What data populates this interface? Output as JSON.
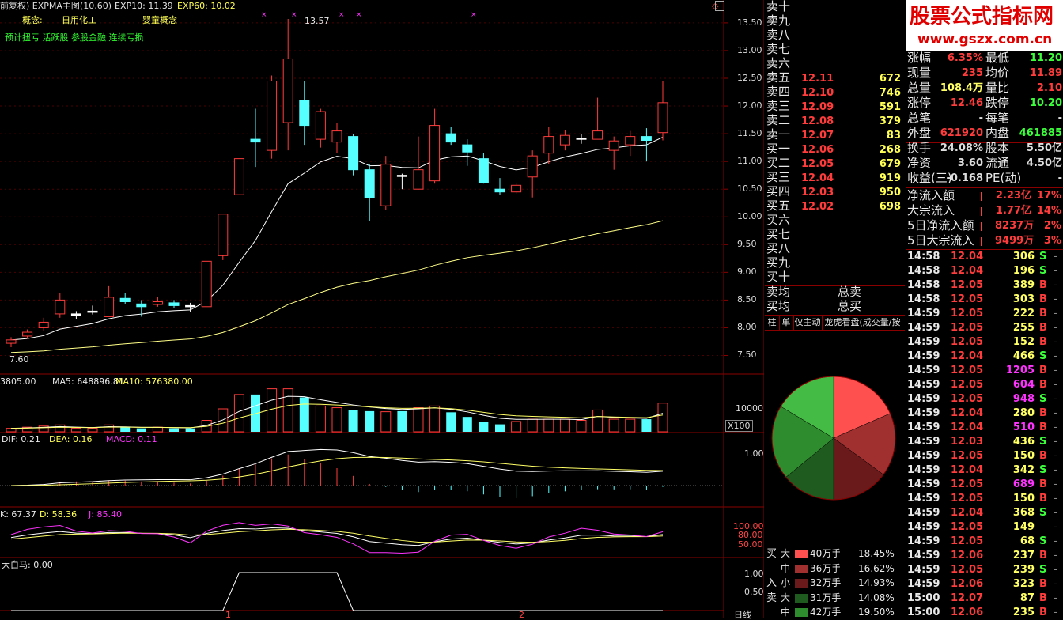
{
  "main_chart": {
    "title": "前复权) EXPMA主图(10,60)",
    "exp10": "EXP10: 11.39",
    "exp60": "EXP60: 10.02",
    "concept_label": "概念:",
    "concept_1": "日用化工",
    "concept_2": "婴童概念",
    "tags": "预计扭亏 活跃股 参股金融 连续亏损",
    "high_mark": "13.57",
    "low_mark": "7.60",
    "price_ticks": [
      "13.50",
      "13.00",
      "12.50",
      "12.00",
      "11.50",
      "11.00",
      "10.50",
      "10.00",
      "9.50",
      "9.00",
      "8.50",
      "8.00",
      "7.50"
    ]
  },
  "volume_panel": {
    "vol": "3805.00",
    "ma5": "MA5: 648896.81",
    "ma10": "MA10: 576380.00",
    "tick": "10000",
    "unit": "X100"
  },
  "macd_panel": {
    "dif": "DIF: 0.21",
    "dea": "DEA: 0.16",
    "macd": "MACD: 0.11",
    "tick": "1.00"
  },
  "kdj_panel": {
    "k": "K: 67.37",
    "d": "D: 58.36",
    "j": "J: 85.40",
    "ticks": [
      "100.00",
      "80.00",
      "50.00"
    ]
  },
  "dbm_panel": {
    "label": "大白马: 0.00",
    "ticks": [
      "1.00",
      "0.50"
    ],
    "axis_1": "1",
    "axis_2": "2",
    "period": "日线"
  },
  "watermark": {
    "title": "股票公式指标网",
    "url": "www.gszx.com.cn"
  },
  "order_book": {
    "sell_empty": [
      "卖十",
      "卖九",
      "卖八",
      "卖七",
      "卖六"
    ],
    "sells": [
      {
        "label": "卖五",
        "price": "12.11",
        "vol": "672"
      },
      {
        "label": "卖四",
        "price": "12.10",
        "vol": "746"
      },
      {
        "label": "卖三",
        "price": "12.09",
        "vol": "591"
      },
      {
        "label": "卖二",
        "price": "12.08",
        "vol": "379"
      },
      {
        "label": "卖一",
        "price": "12.07",
        "vol": "83"
      }
    ],
    "buys": [
      {
        "label": "买一",
        "price": "12.06",
        "vol": "268"
      },
      {
        "label": "买二",
        "price": "12.05",
        "vol": "679"
      },
      {
        "label": "买三",
        "price": "12.04",
        "vol": "919"
      },
      {
        "label": "买四",
        "price": "12.03",
        "vol": "950"
      },
      {
        "label": "买五",
        "price": "12.02",
        "vol": "698"
      }
    ],
    "buy_empty": [
      "买六",
      "买七",
      "买八",
      "买九",
      "买十"
    ],
    "avg_sell": "卖均",
    "avg_buy": "买均",
    "total_sell": "总卖",
    "total_buy": "总买"
  },
  "tabs": [
    "柱",
    "单",
    "仅主动",
    "龙虎看盘(成交量/按"
  ],
  "stats": [
    {
      "l1": "涨幅",
      "v1": "6.35%",
      "l2": "最低",
      "v2": "11.20"
    },
    {
      "l1": "现量",
      "v1": "235",
      "l2": "均价",
      "v2": "11.89"
    },
    {
      "l1": "总量",
      "v1": "108.4万",
      "l2": "量比",
      "v2": "2.10"
    },
    {
      "l1": "涨停",
      "v1": "12.46",
      "l2": "跌停",
      "v2": "10.20"
    },
    {
      "l1": "总笔",
      "v1": "-",
      "l2": "每笔",
      "v2": "-"
    },
    {
      "l1": "外盘",
      "v1": "621920",
      "l2": "内盘",
      "v2": "461885"
    },
    {
      "l1": "换手",
      "v1": "24.08%",
      "l2": "股本",
      "v2": "5.50亿"
    },
    {
      "l1": "净资",
      "v1": "3.60",
      "l2": "流通",
      "v2": "4.50亿"
    },
    {
      "l1": "收益(三)",
      "v1": "-0.168",
      "l2": "PE(动)",
      "v2": "-"
    }
  ],
  "flows": [
    {
      "label": "净流入额",
      "val": "2.23亿",
      "pct": "17%"
    },
    {
      "label": "大宗流入",
      "val": "1.77亿",
      "pct": "14%"
    },
    {
      "label": "5日净流入额",
      "val": "8237万",
      "pct": "2%"
    },
    {
      "label": "5日大宗流入",
      "val": "9499万",
      "pct": "3%"
    }
  ],
  "pie": {
    "slices": [
      {
        "pct": 18.45,
        "color": "#ff5050"
      },
      {
        "pct": 16.62,
        "color": "#a03030"
      },
      {
        "pct": 14.93,
        "color": "#6a1a1a"
      },
      {
        "pct": 14.08,
        "color": "#1f5a1f"
      },
      {
        "pct": 19.5,
        "color": "#2e8b2e"
      },
      {
        "pct": 16.42,
        "color": "#44bb44"
      }
    ]
  },
  "legend": [
    {
      "side": "买",
      "size": "大",
      "amt": "40万手",
      "pct": "18.45%",
      "color": "#ff5050"
    },
    {
      "side": "",
      "size": "中",
      "amt": "36万手",
      "pct": "16.62%",
      "color": "#a03030"
    },
    {
      "side": "入",
      "size": "小",
      "amt": "32万手",
      "pct": "14.93%",
      "color": "#6a1a1a"
    },
    {
      "side": "卖",
      "size": "大",
      "amt": "31万手",
      "pct": "14.08%",
      "color": "#1f5a1f"
    },
    {
      "side": "",
      "size": "中",
      "amt": "42万手",
      "pct": "19.50%",
      "color": "#2e8b2e"
    }
  ],
  "ticks": [
    {
      "t": "14:58",
      "p": "12.04",
      "v": "306",
      "s": "S"
    },
    {
      "t": "14:58",
      "p": "12.04",
      "v": "196",
      "s": "S"
    },
    {
      "t": "14:58",
      "p": "12.05",
      "v": "389",
      "s": "B"
    },
    {
      "t": "14:58",
      "p": "12.05",
      "v": "303",
      "s": "B"
    },
    {
      "t": "14:59",
      "p": "12.05",
      "v": "222",
      "s": "B"
    },
    {
      "t": "14:59",
      "p": "12.05",
      "v": "255",
      "s": "B"
    },
    {
      "t": "14:59",
      "p": "12.05",
      "v": "152",
      "s": "B"
    },
    {
      "t": "14:59",
      "p": "12.04",
      "v": "466",
      "s": "S"
    },
    {
      "t": "14:59",
      "p": "12.05",
      "v": "1205",
      "s": "B"
    },
    {
      "t": "14:59",
      "p": "12.05",
      "v": "604",
      "s": "B"
    },
    {
      "t": "14:59",
      "p": "12.05",
      "v": "948",
      "s": "S"
    },
    {
      "t": "14:59",
      "p": "12.04",
      "v": "280",
      "s": "B"
    },
    {
      "t": "14:59",
      "p": "12.04",
      "v": "510",
      "s": "B"
    },
    {
      "t": "14:59",
      "p": "12.03",
      "v": "436",
      "s": "S"
    },
    {
      "t": "14:59",
      "p": "12.05",
      "v": "150",
      "s": "B"
    },
    {
      "t": "14:59",
      "p": "12.04",
      "v": "342",
      "s": "S"
    },
    {
      "t": "14:59",
      "p": "12.05",
      "v": "689",
      "s": "B"
    },
    {
      "t": "14:59",
      "p": "12.05",
      "v": "150",
      "s": "B"
    },
    {
      "t": "14:59",
      "p": "12.04",
      "v": "368",
      "s": "S"
    },
    {
      "t": "14:59",
      "p": "12.05",
      "v": "149",
      "s": ""
    },
    {
      "t": "14:59",
      "p": "12.05",
      "v": "68",
      "s": "S"
    },
    {
      "t": "14:59",
      "p": "12.06",
      "v": "237",
      "s": "B"
    },
    {
      "t": "14:59",
      "p": "12.05",
      "v": "239",
      "s": "S"
    },
    {
      "t": "14:59",
      "p": "12.06",
      "v": "323",
      "s": "B"
    },
    {
      "t": "15:00",
      "p": "12.07",
      "v": "87",
      "s": "B"
    },
    {
      "t": "15:00",
      "p": "12.06",
      "v": "235",
      "s": "B"
    }
  ],
  "candles": [
    {
      "o": 7.72,
      "c": 7.78,
      "h": 7.83,
      "l": 7.65
    },
    {
      "o": 7.85,
      "c": 7.92,
      "h": 7.97,
      "l": 7.8
    },
    {
      "o": 8.0,
      "c": 8.1,
      "h": 8.18,
      "l": 7.95
    },
    {
      "o": 8.25,
      "c": 8.5,
      "h": 8.62,
      "l": 8.18
    },
    {
      "o": 8.22,
      "c": 8.25,
      "h": 8.3,
      "l": 8.15
    },
    {
      "o": 8.28,
      "c": 8.3,
      "h": 8.4,
      "l": 8.24
    },
    {
      "o": 8.2,
      "c": 8.55,
      "h": 8.75,
      "l": 8.2
    },
    {
      "o": 8.53,
      "c": 8.47,
      "h": 8.62,
      "l": 8.42
    },
    {
      "o": 8.43,
      "c": 8.38,
      "h": 8.5,
      "l": 8.2
    },
    {
      "o": 8.42,
      "c": 8.47,
      "h": 8.55,
      "l": 8.38
    },
    {
      "o": 8.45,
      "c": 8.4,
      "h": 8.5,
      "l": 8.36
    },
    {
      "o": 8.4,
      "c": 8.38,
      "h": 8.45,
      "l": 8.28
    },
    {
      "o": 8.38,
      "c": 9.2,
      "h": 9.2,
      "l": 8.38
    },
    {
      "o": 9.3,
      "c": 10.05,
      "h": 10.05,
      "l": 9.22
    },
    {
      "o": 10.4,
      "c": 11.05,
      "h": 11.05,
      "l": 10.4
    },
    {
      "o": 11.4,
      "c": 11.35,
      "h": 11.95,
      "l": 10.9
    },
    {
      "o": 11.2,
      "c": 12.45,
      "h": 12.55,
      "l": 11.05
    },
    {
      "o": 11.7,
      "c": 12.85,
      "h": 13.57,
      "l": 11.2
    },
    {
      "o": 12.1,
      "c": 11.65,
      "h": 12.45,
      "l": 11.3
    },
    {
      "o": 11.4,
      "c": 11.9,
      "h": 11.95,
      "l": 11.25
    },
    {
      "o": 11.35,
      "c": 11.55,
      "h": 11.7,
      "l": 11.15
    },
    {
      "o": 11.45,
      "c": 10.85,
      "h": 11.5,
      "l": 10.75
    },
    {
      "o": 10.85,
      "c": 10.35,
      "h": 10.95,
      "l": 9.92
    },
    {
      "o": 10.2,
      "c": 10.95,
      "h": 11.1,
      "l": 10.12
    },
    {
      "o": 10.75,
      "c": 10.73,
      "h": 10.78,
      "l": 10.5
    },
    {
      "o": 10.5,
      "c": 10.85,
      "h": 11.45,
      "l": 10.5
    },
    {
      "o": 10.65,
      "c": 11.65,
      "h": 11.95,
      "l": 10.6
    },
    {
      "o": 11.5,
      "c": 11.35,
      "h": 11.62,
      "l": 11.3
    },
    {
      "o": 11.3,
      "c": 11.17,
      "h": 11.4,
      "l": 10.92
    },
    {
      "o": 11.05,
      "c": 10.62,
      "h": 11.15,
      "l": 10.6
    },
    {
      "o": 10.5,
      "c": 10.45,
      "h": 10.7,
      "l": 10.4
    },
    {
      "o": 10.45,
      "c": 10.57,
      "h": 10.62,
      "l": 10.42
    },
    {
      "o": 10.72,
      "c": 11.1,
      "h": 11.2,
      "l": 10.35
    },
    {
      "o": 11.15,
      "c": 11.45,
      "h": 11.62,
      "l": 10.95
    },
    {
      "o": 11.3,
      "c": 11.47,
      "h": 11.57,
      "l": 11.2
    },
    {
      "o": 11.4,
      "c": 11.42,
      "h": 11.5,
      "l": 11.32
    },
    {
      "o": 11.4,
      "c": 11.55,
      "h": 12.15,
      "l": 11.4
    },
    {
      "o": 11.2,
      "c": 11.37,
      "h": 11.45,
      "l": 10.85
    },
    {
      "o": 11.3,
      "c": 11.45,
      "h": 11.55,
      "l": 11.1
    },
    {
      "o": 11.45,
      "c": 11.38,
      "h": 11.6,
      "l": 11.0
    },
    {
      "o": 11.52,
      "c": 12.06,
      "h": 12.45,
      "l": 11.38
    }
  ],
  "volumes": [
    0.06,
    0.08,
    0.1,
    0.12,
    0.06,
    0.06,
    0.12,
    0.08,
    0.06,
    0.08,
    0.06,
    0.06,
    0.2,
    0.4,
    0.65,
    0.65,
    0.75,
    0.75,
    0.6,
    0.45,
    0.42,
    0.38,
    0.36,
    0.35,
    0.36,
    0.42,
    0.45,
    0.34,
    0.26,
    0.17,
    0.13,
    0.18,
    0.22,
    0.22,
    0.22,
    0.2,
    0.38,
    0.22,
    0.22,
    0.22,
    0.5
  ],
  "dbm_series": [
    0,
    0,
    0,
    0,
    0,
    0,
    0,
    0,
    0,
    0,
    0,
    0,
    0,
    0,
    1,
    1,
    1,
    1,
    1,
    1,
    1,
    0,
    0,
    0,
    0,
    0,
    0,
    0,
    0,
    0,
    0,
    0,
    0,
    0,
    0,
    0,
    0,
    0,
    0,
    0,
    0
  ]
}
